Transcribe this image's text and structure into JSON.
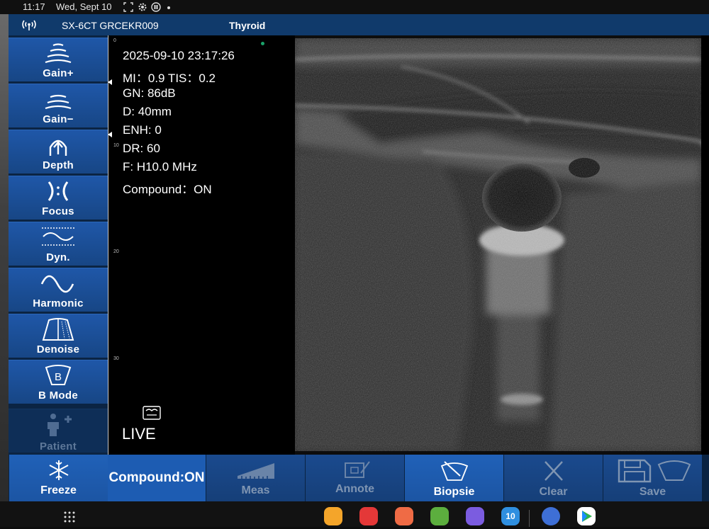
{
  "status_bar": {
    "time": "11:17",
    "date": "Wed, Sept 10"
  },
  "title_bar": {
    "device": "SX-6CT GRCEKR009",
    "preset": "Thyroid"
  },
  "left_menu": [
    {
      "label": "Gain+",
      "icon": "gain-plus-icon"
    },
    {
      "label": "Gain−",
      "icon": "gain-minus-icon"
    },
    {
      "label": "Depth",
      "icon": "depth-icon"
    },
    {
      "label": "Focus",
      "icon": "focus-icon"
    },
    {
      "label": "Dyn.",
      "icon": "dynamic-range-icon"
    },
    {
      "label": "Harmonic",
      "icon": "harmonic-wave-icon"
    },
    {
      "label": "Denoise",
      "icon": "denoise-icon"
    },
    {
      "label": "B Mode",
      "icon": "b-mode-icon"
    },
    {
      "label": "Patient",
      "icon": "patient-icon",
      "disabled": true
    }
  ],
  "scan_info": {
    "datetime": "2025-09-10 23:17:26",
    "mi_tis": "MI：0.9  TIS：0.2",
    "gain": "GN: 86dB",
    "depth": "D: 40mm",
    "enhance": "ENH: 0",
    "dynamic_range": "DR: 60",
    "frequency": "F: H10.0 MHz",
    "compound": "Compound：ON"
  },
  "ruler_labels": [
    "0",
    "10",
    "20",
    "30"
  ],
  "live_label": "LIVE",
  "bottom_bar": {
    "freeze": "Freeze",
    "compound_toggle": "Compound:ON",
    "meas": "Meas",
    "annote": "Annote",
    "biopsie": "Biopsie",
    "clear": "Clear",
    "save": "Save"
  },
  "taskbar": {
    "calendar_day": "10"
  },
  "colors": {
    "accent": "#1d5cb2",
    "title_bar": "#103a6b",
    "menu_button": "#1f57a8"
  }
}
